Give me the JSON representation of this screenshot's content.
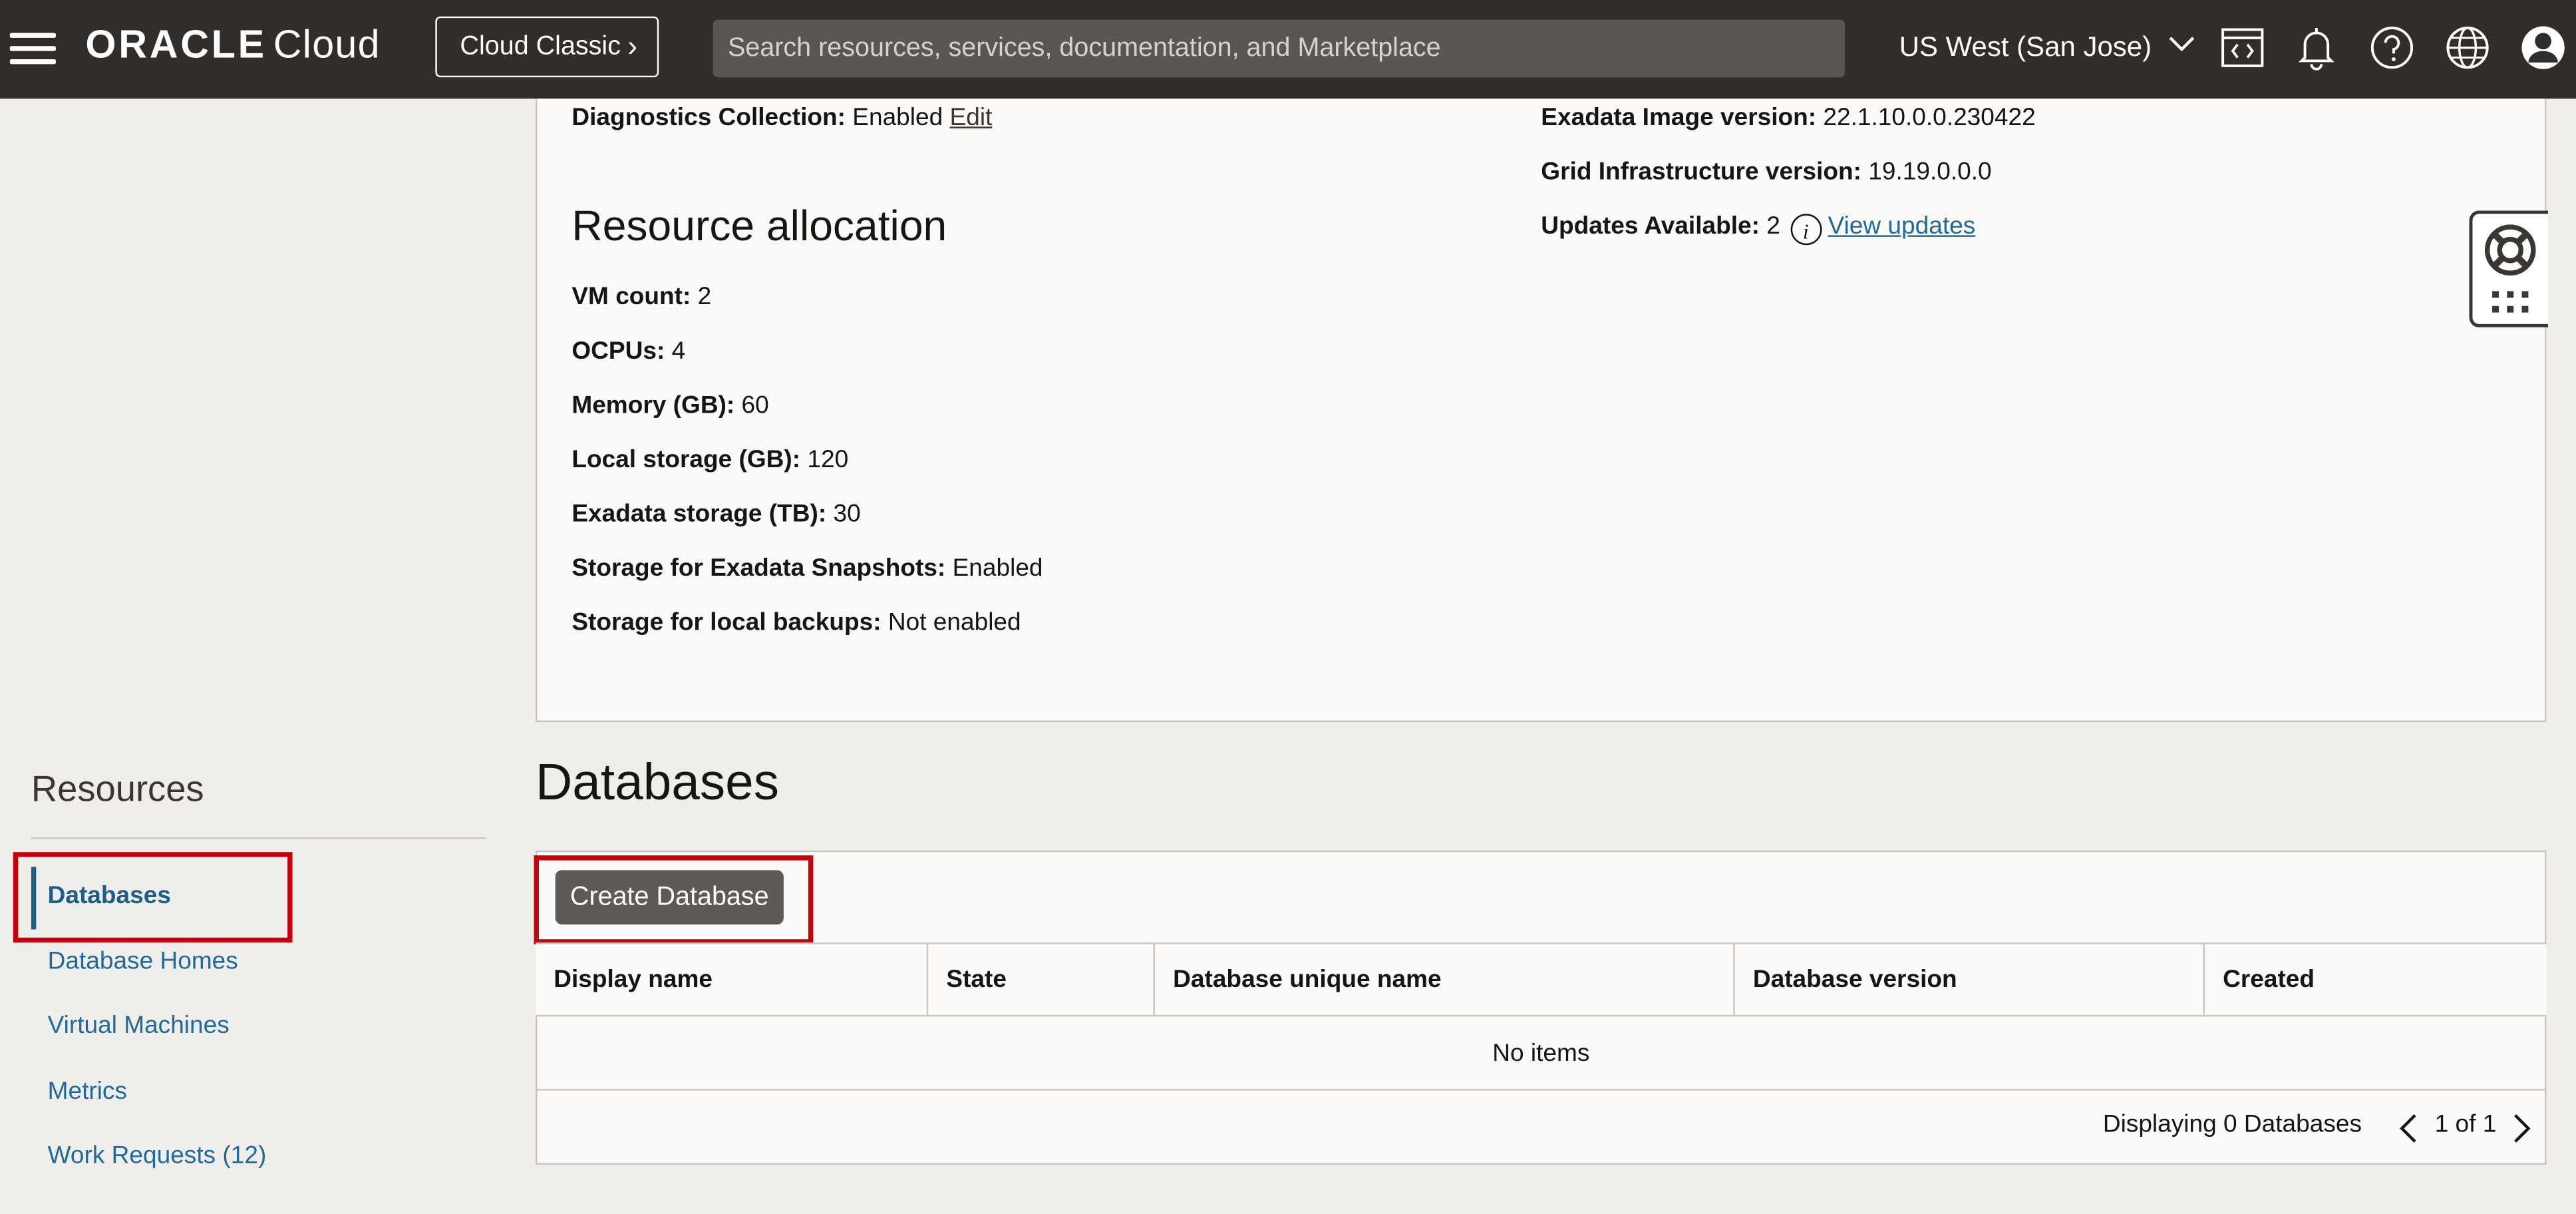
{
  "header": {
    "logo_brand": "ORACLE",
    "logo_product": "Cloud",
    "classic_label": "Cloud Classic",
    "search_placeholder": "Search resources, services, documentation, and Marketplace",
    "region": "US West (San Jose)"
  },
  "details": {
    "diagnostics": {
      "label": "Diagnostics Collection:",
      "value": "Enabled",
      "link": "Edit"
    },
    "image_version": {
      "label": "Exadata Image version:",
      "value": "22.1.10.0.0.230422"
    },
    "grid_version": {
      "label": "Grid Infrastructure version:",
      "value": "19.19.0.0.0"
    },
    "updates": {
      "label": "Updates Available:",
      "value": "2",
      "link": "View updates"
    },
    "resource_allocation_title": "Resource allocation",
    "resource_allocation": [
      {
        "label": "VM count:",
        "value": "2"
      },
      {
        "label": "OCPUs:",
        "value": "4"
      },
      {
        "label": "Memory (GB):",
        "value": "60"
      },
      {
        "label": "Local storage (GB):",
        "value": "120"
      },
      {
        "label": "Exadata storage (TB):",
        "value": "30"
      },
      {
        "label": "Storage for Exadata Snapshots:",
        "value": "Enabled"
      },
      {
        "label": "Storage for local backups:",
        "value": "Not enabled"
      }
    ]
  },
  "resources": {
    "title": "Resources",
    "items": [
      {
        "label": "Databases",
        "active": true
      },
      {
        "label": "Database Homes"
      },
      {
        "label": "Virtual Machines"
      },
      {
        "label": "Metrics"
      },
      {
        "label": "Work Requests (12)"
      }
    ]
  },
  "databases": {
    "title": "Databases",
    "create_label": "Create Database",
    "columns": [
      "Display name",
      "State",
      "Database unique name",
      "Database version",
      "Created"
    ],
    "empty_text": "No items",
    "display_count": "Displaying 0 Databases",
    "page_info": "1 of 1"
  },
  "colors": {
    "topbar": "#312d2a",
    "link": "#1f6a9a",
    "highlight": "#c7000a",
    "button": "#5f5a55"
  }
}
